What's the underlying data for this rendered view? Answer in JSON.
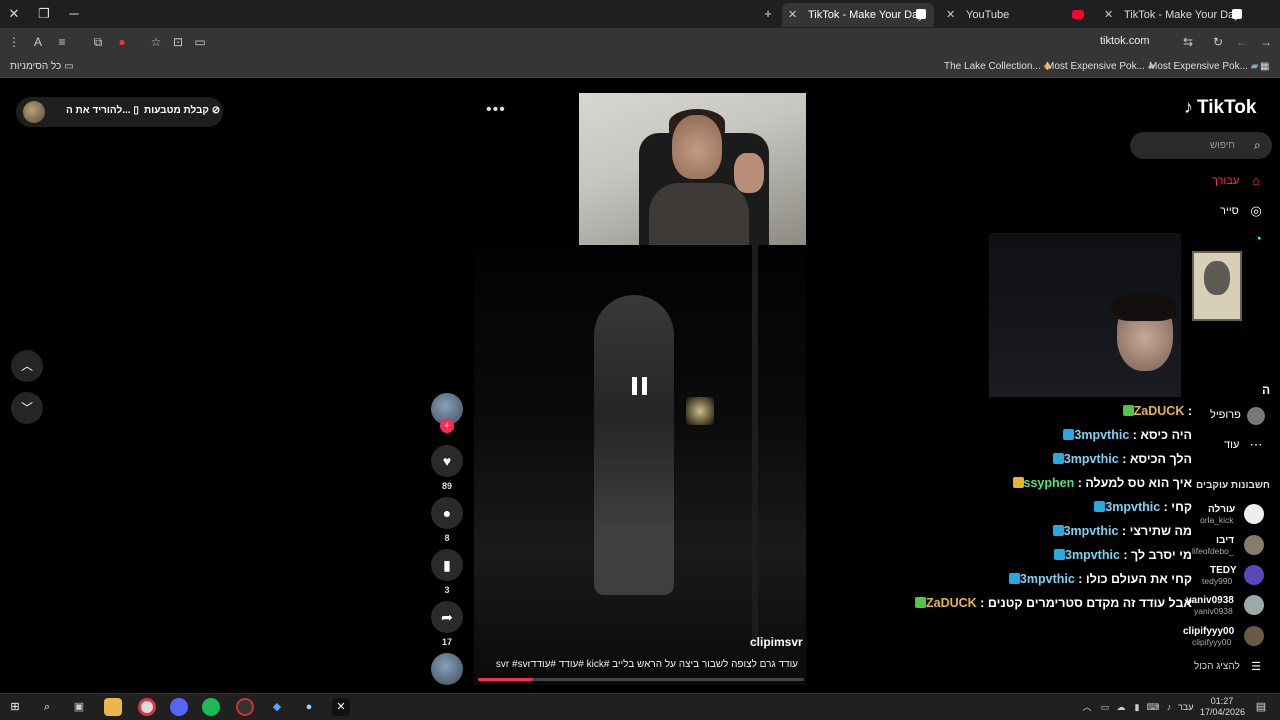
{
  "browser": {
    "tabs": [
      {
        "label": "TikTok - Make Your Day",
        "active": true
      },
      {
        "label": "YouTube",
        "active": false
      },
      {
        "label": "TikTok - Make Your Day",
        "active": false
      }
    ],
    "url": "tiktok.com",
    "bookmarks_all": "כל הסימניות",
    "bookmarks": [
      "The Lake Collection...",
      "Most Expensive Pok...",
      "Most Expensive Pok..."
    ]
  },
  "page": {
    "pill": {
      "coins_label": "קבלת מטבעות",
      "download_label": "להוריד את ה..."
    },
    "video": {
      "author": "clipimsvr",
      "caption": "עודד גרם לצופה לשבור ביצה על הראש בלייב #kick #עודד #עודדsvr #svr",
      "progress": 0.17
    },
    "actions": {
      "likes": "89",
      "comments": "8",
      "saves": "3",
      "shares": "17"
    }
  },
  "sidebar": {
    "logo": "TikTok",
    "search_placeholder": "חיפוש",
    "nav": [
      {
        "label": "עבורך",
        "icon": "home-icon"
      },
      {
        "label": "סייר",
        "icon": "compass-icon"
      }
    ],
    "profile_label": "פרופיל",
    "more_label": "עוד",
    "following_heading": "חשבונות עוקבים",
    "letter": "ה",
    "accounts": [
      {
        "name": "עורלה",
        "handle": "orla_kick"
      },
      {
        "name": "דיבו",
        "handle": "lifeofdebo_"
      },
      {
        "name": "TEDY",
        "handle": "tedy990"
      },
      {
        "name": "yaniv0938",
        "handle": "yaniv0938"
      },
      {
        "name": "clipifyyy00",
        "handle": "clipifyyy00"
      }
    ],
    "show_all": "להציג הכול"
  },
  "chat": [
    {
      "user": "ZaDUCK",
      "message": "",
      "color": "gold"
    },
    {
      "user": "3mpvthic",
      "message": "היה כיסא",
      "color": "blue"
    },
    {
      "user": "3mpvthic",
      "message": "הלך הכיסא",
      "color": "blue"
    },
    {
      "user": "ssyphen",
      "message": "איך הוא טס למעלה",
      "color": "green"
    },
    {
      "user": "3mpvthic",
      "message": "קחי",
      "color": "blue"
    },
    {
      "user": "3mpvthic",
      "message": "מה שתירצי",
      "color": "blue"
    },
    {
      "user": "3mpvthic",
      "message": "מי יסרב לך",
      "color": "blue"
    },
    {
      "user": "3mpvthic",
      "message": "קחי את העולם כולו",
      "color": "blue"
    },
    {
      "user": "ZaDUCK",
      "message": "אבל עודד זה מקדם סטרימרים קטנים",
      "color": "gold"
    }
  ],
  "taskbar": {
    "time": "01:27",
    "date": "17/04/2026",
    "lang": "עבר"
  }
}
